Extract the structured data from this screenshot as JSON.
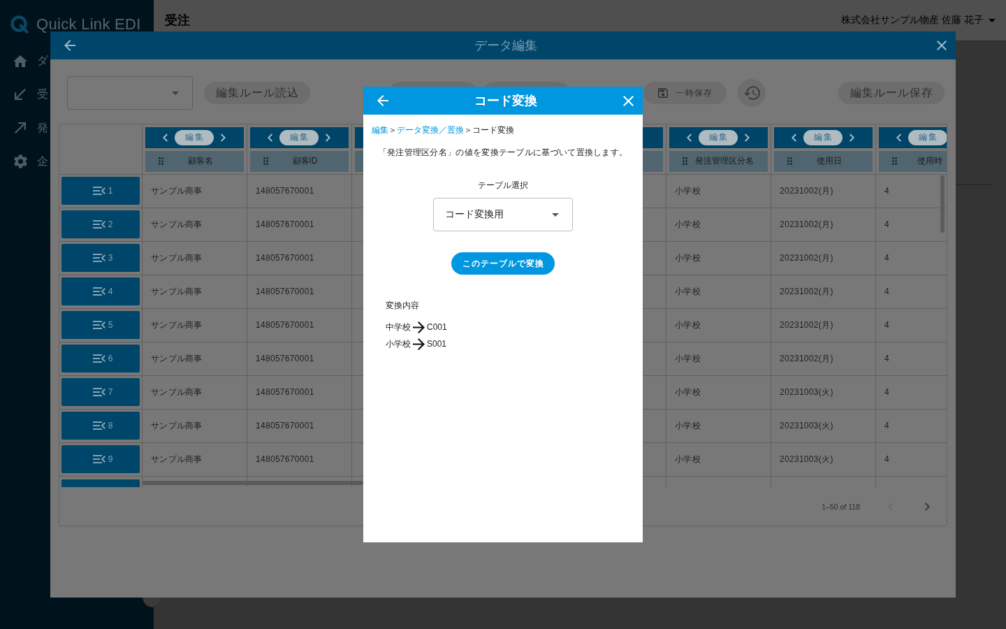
{
  "sidebar": {
    "logo": "Quick Link EDI",
    "items": [
      {
        "label": "ダ"
      },
      {
        "label": "受"
      },
      {
        "label": "発"
      },
      {
        "label": "企"
      }
    ]
  },
  "header": {
    "title": "受注",
    "user": "株式会社サンプル物産 佐藤 花子"
  },
  "dialog": {
    "title": "データ編集",
    "toolbar": {
      "load_rule_button": "編集ルール読込",
      "temp_save_button": "一時保存",
      "save_rule_button": "編集ルール保存"
    },
    "table": {
      "columns": [
        {
          "kind": "full",
          "title": "顧客名",
          "edit_label": "編集"
        },
        {
          "kind": "full",
          "title": "顧客ID",
          "edit_label": "編集"
        },
        {
          "kind": "covered"
        },
        {
          "kind": "covered"
        },
        {
          "kind": "covered"
        },
        {
          "kind": "full",
          "title": "発注管理区分名",
          "edit_label": "編集"
        },
        {
          "kind": "full",
          "title": "使用日",
          "edit_label": "編集"
        },
        {
          "kind": "cut",
          "title": "使用時",
          "edit_label": "編集"
        }
      ],
      "rows": [
        {
          "number": "1",
          "cells": [
            "サンプル商事",
            "148057670001",
            "",
            "",
            "",
            "小学校",
            "20231002(月)",
            "4"
          ]
        },
        {
          "number": "2",
          "cells": [
            "サンプル商事",
            "148057670001",
            "",
            "",
            "",
            "小学校",
            "20231002(月)",
            "4"
          ]
        },
        {
          "number": "3",
          "cells": [
            "サンプル商事",
            "148057670001",
            "",
            "",
            "",
            "小学校",
            "20231002(月)",
            "4"
          ]
        },
        {
          "number": "4",
          "cells": [
            "サンプル商事",
            "148057670001",
            "",
            "",
            "",
            "小学校",
            "20231002(月)",
            "4"
          ]
        },
        {
          "number": "5",
          "cells": [
            "サンプル商事",
            "148057670001",
            "",
            "",
            "",
            "小学校",
            "20231002(月)",
            "4"
          ]
        },
        {
          "number": "6",
          "cells": [
            "サンプル商事",
            "148057670001",
            "",
            "",
            "",
            "小学校",
            "20231002(月)",
            "4"
          ]
        },
        {
          "number": "7",
          "cells": [
            "サンプル商事",
            "148057670001",
            "",
            "",
            "",
            "小学校",
            "20231003(火)",
            "4"
          ]
        },
        {
          "number": "8",
          "cells": [
            "サンプル商事",
            "148057670001",
            "",
            "",
            "",
            "小学校",
            "20231003(火)",
            "4"
          ]
        },
        {
          "number": "9",
          "cells": [
            "サンプル商事",
            "148057670001",
            "",
            "",
            "",
            "小学校",
            "20231003(火)",
            "4"
          ]
        }
      ],
      "pagination": {
        "range": "1–50 of 118",
        "prev_disabled": true,
        "next_disabled": false
      }
    }
  },
  "modal": {
    "title": "コード変換",
    "breadcrumb": [
      {
        "kind": "link",
        "label": "編集"
      },
      {
        "kind": "separator",
        "label": "＞"
      },
      {
        "kind": "link",
        "label": "データ変換／置換"
      },
      {
        "kind": "separator",
        "label": "＞"
      },
      {
        "kind": "current",
        "label": "コード変換"
      }
    ],
    "description": "「発注管理区分名」の値を変換テーブルに基づいて置換します。",
    "table_select": {
      "label": "テーブル選択",
      "value": "コード変換用"
    },
    "convert_button": "このテーブルで変換",
    "mapping": {
      "title": "変換内容",
      "entries": [
        {
          "from": "中学校",
          "to": "C001"
        },
        {
          "from": "小学校",
          "to": "S001"
        }
      ]
    }
  }
}
